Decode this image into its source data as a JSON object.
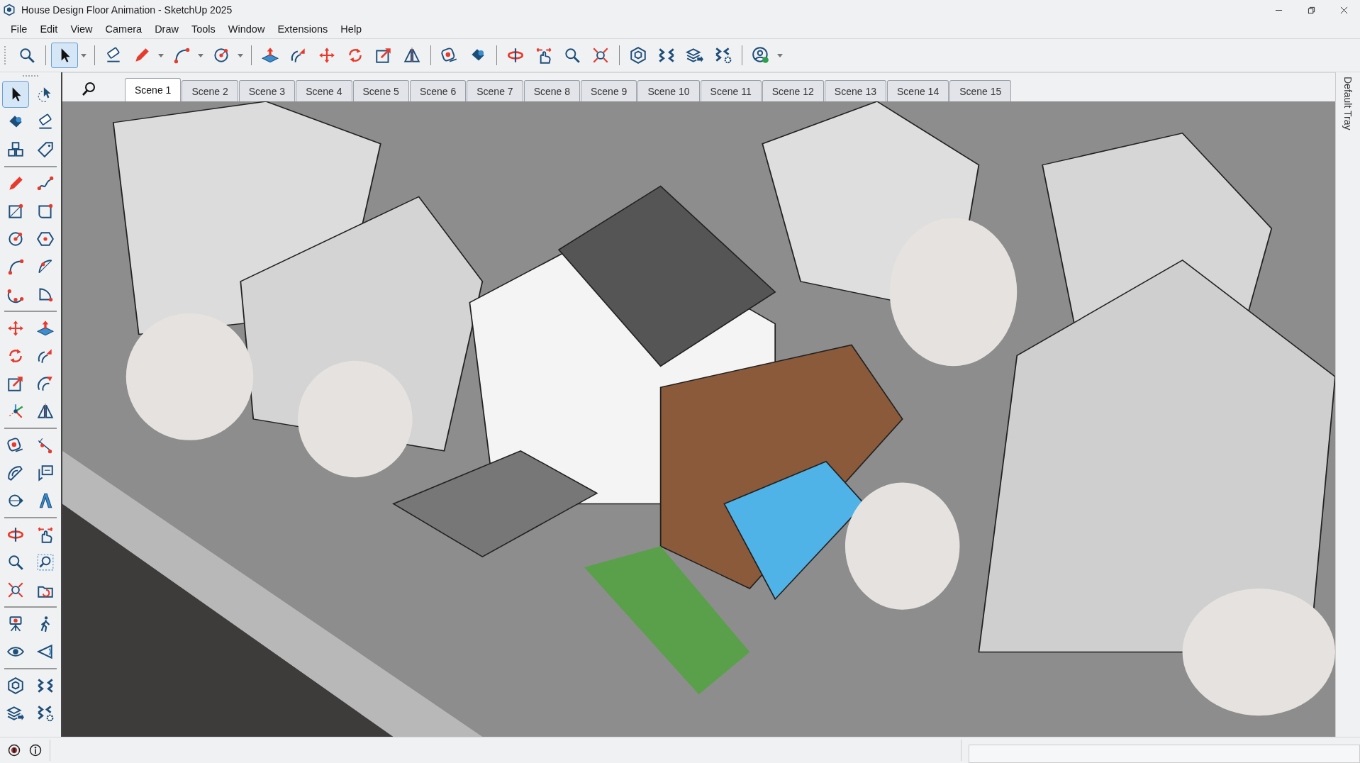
{
  "window": {
    "title": "House Design Floor Animation - SketchUp 2025"
  },
  "menu": [
    "File",
    "Edit",
    "View",
    "Camera",
    "Draw",
    "Tools",
    "Window",
    "Extensions",
    "Help"
  ],
  "toolbar": [
    {
      "tools": [
        {
          "kind": "search",
          "selected": false,
          "dropdown": false
        }
      ]
    },
    {
      "tools": [
        {
          "kind": "select",
          "selected": true,
          "dropdown": true
        }
      ]
    },
    {
      "tools": [
        {
          "kind": "eraser",
          "selected": false,
          "dropdown": false
        },
        {
          "kind": "pencil",
          "selected": false,
          "dropdown": true
        },
        {
          "kind": "arc",
          "selected": false,
          "dropdown": true
        },
        {
          "kind": "circle",
          "selected": false,
          "dropdown": true
        }
      ]
    },
    {
      "tools": [
        {
          "kind": "pushpull",
          "selected": false,
          "dropdown": false
        },
        {
          "kind": "followme",
          "selected": false,
          "dropdown": false
        },
        {
          "kind": "move",
          "selected": false,
          "dropdown": false
        },
        {
          "kind": "rotate",
          "selected": false,
          "dropdown": false
        },
        {
          "kind": "scale",
          "selected": false,
          "dropdown": false
        },
        {
          "kind": "flip",
          "selected": false,
          "dropdown": false
        }
      ]
    },
    {
      "tools": [
        {
          "kind": "tape",
          "selected": false,
          "dropdown": false
        },
        {
          "kind": "paint",
          "selected": false,
          "dropdown": false
        }
      ]
    },
    {
      "tools": [
        {
          "kind": "orbit",
          "selected": false,
          "dropdown": false
        },
        {
          "kind": "pan",
          "selected": false,
          "dropdown": false
        },
        {
          "kind": "zoom",
          "selected": false,
          "dropdown": false
        },
        {
          "kind": "zoomextents",
          "selected": false,
          "dropdown": false
        }
      ]
    },
    {
      "tools": [
        {
          "kind": "warehouse",
          "selected": false,
          "dropdown": false
        },
        {
          "kind": "extwarehouse",
          "selected": false,
          "dropdown": false
        },
        {
          "kind": "layout",
          "selected": false,
          "dropdown": false
        },
        {
          "kind": "extmanager",
          "selected": false,
          "dropdown": false
        }
      ]
    },
    {
      "tools": [
        {
          "kind": "profile",
          "selected": false,
          "dropdown": true
        }
      ]
    }
  ],
  "palette": [
    {
      "tools": [
        {
          "kind": "select",
          "selected": true
        },
        {
          "kind": "lasso",
          "selected": false
        },
        {
          "kind": "paint",
          "selected": false
        },
        {
          "kind": "eraser",
          "selected": false
        },
        {
          "kind": "component",
          "selected": false
        },
        {
          "kind": "tag",
          "selected": false
        }
      ]
    },
    {
      "tools": [
        {
          "kind": "pencil",
          "selected": false
        },
        {
          "kind": "freehand",
          "selected": false
        },
        {
          "kind": "rectangle",
          "selected": false
        },
        {
          "kind": "rotrect",
          "selected": false
        },
        {
          "kind": "circle",
          "selected": false
        },
        {
          "kind": "polygon",
          "selected": false
        },
        {
          "kind": "arc",
          "selected": false
        },
        {
          "kind": "arc2",
          "selected": false
        },
        {
          "kind": "arc3",
          "selected": false
        },
        {
          "kind": "pie",
          "selected": false
        }
      ]
    },
    {
      "tools": [
        {
          "kind": "move",
          "selected": false
        },
        {
          "kind": "pushpull",
          "selected": false
        },
        {
          "kind": "rotate",
          "selected": false
        },
        {
          "kind": "followme",
          "selected": false
        },
        {
          "kind": "scale",
          "selected": false
        },
        {
          "kind": "offset",
          "selected": false
        },
        {
          "kind": "axes",
          "selected": false
        },
        {
          "kind": "flip",
          "selected": false
        }
      ]
    },
    {
      "tools": [
        {
          "kind": "tape",
          "selected": false
        },
        {
          "kind": "dimension",
          "selected": false
        },
        {
          "kind": "protractor",
          "selected": false
        },
        {
          "kind": "text",
          "selected": false
        },
        {
          "kind": "section",
          "selected": false
        },
        {
          "kind": "text3d",
          "selected": false
        }
      ]
    },
    {
      "tools": [
        {
          "kind": "orbit",
          "selected": false
        },
        {
          "kind": "pan",
          "selected": false
        },
        {
          "kind": "zoom",
          "selected": false
        },
        {
          "kind": "zoomwindow",
          "selected": false
        },
        {
          "kind": "zoomextents",
          "selected": false
        },
        {
          "kind": "previous",
          "selected": false
        }
      ]
    },
    {
      "tools": [
        {
          "kind": "camera",
          "selected": false
        },
        {
          "kind": "walk",
          "selected": false
        },
        {
          "kind": "look",
          "selected": false
        },
        {
          "kind": "cone",
          "selected": false
        }
      ]
    },
    {
      "tools": [
        {
          "kind": "warehouse",
          "selected": false
        },
        {
          "kind": "extwarehouse",
          "selected": false
        },
        {
          "kind": "layout",
          "selected": false
        },
        {
          "kind": "extmanager",
          "selected": false
        }
      ]
    }
  ],
  "scene_tabs": [
    {
      "label": "Scene 1",
      "selected": true
    },
    {
      "label": "Scene 2",
      "selected": false
    },
    {
      "label": "Scene 3",
      "selected": false
    },
    {
      "label": "Scene 4",
      "selected": false
    },
    {
      "label": "Scene 5",
      "selected": false
    },
    {
      "label": "Scene 6",
      "selected": false
    },
    {
      "label": "Scene 7",
      "selected": false
    },
    {
      "label": "Scene 8",
      "selected": false
    },
    {
      "label": "Scene 9",
      "selected": false
    },
    {
      "label": "Scene 10",
      "selected": false
    },
    {
      "label": "Scene 11",
      "selected": false
    },
    {
      "label": "Scene 12",
      "selected": false
    },
    {
      "label": "Scene 13",
      "selected": false
    },
    {
      "label": "Scene 14",
      "selected": false
    },
    {
      "label": "Scene 15",
      "selected": false
    }
  ],
  "tray": {
    "label": "Default Tray"
  }
}
